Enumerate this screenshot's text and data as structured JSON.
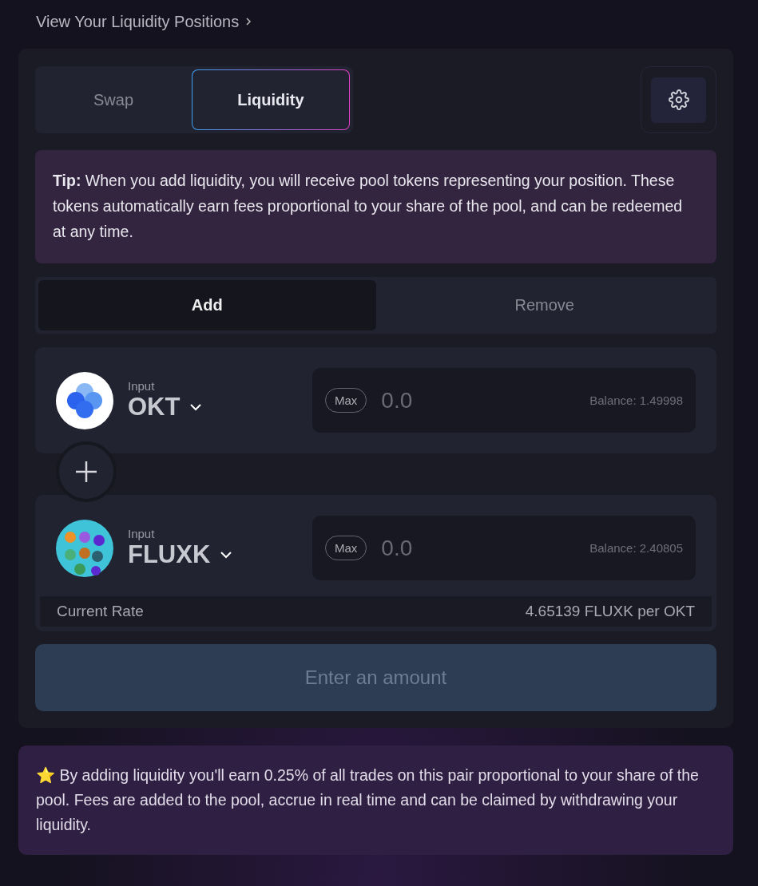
{
  "positions_link": {
    "label": "View Your Liquidity Positions"
  },
  "tabs": [
    {
      "label": "Swap",
      "selected": false
    },
    {
      "label": "Liquidity",
      "selected": true
    }
  ],
  "tip": {
    "text": "**Tip:** When you add liquidity, you will receive pool tokens representing your position. These tokens automatically earn fees proportional to your share of the pool, and can be redeemed at any time."
  },
  "mode_tabs": [
    {
      "label": "Add",
      "selected": true
    },
    {
      "label": "Remove",
      "selected": false
    }
  ],
  "tokens": [
    {
      "kind": "okt",
      "label": "Input",
      "symbol": "OKT",
      "max_label": "Max",
      "placeholder": "0.0",
      "balance": "Balance: 1.49998"
    },
    {
      "kind": "fluxk",
      "label": "Input",
      "symbol": "FLUXK",
      "max_label": "Max",
      "placeholder": "0.0",
      "balance": "Balance: 2.40805"
    }
  ],
  "rate": {
    "label": "Current Rate",
    "value": "4.65139 FLUXK per OKT"
  },
  "submit": {
    "label": "Enter an amount",
    "disabled": true
  },
  "note": {
    "text": "⭐ By adding liquidity you'll earn 0.25% of all trades on this pair proportional to your share of the pool. Fees are added to the pool, accrue in real time and can be claimed by withdrawing your liquidity."
  }
}
